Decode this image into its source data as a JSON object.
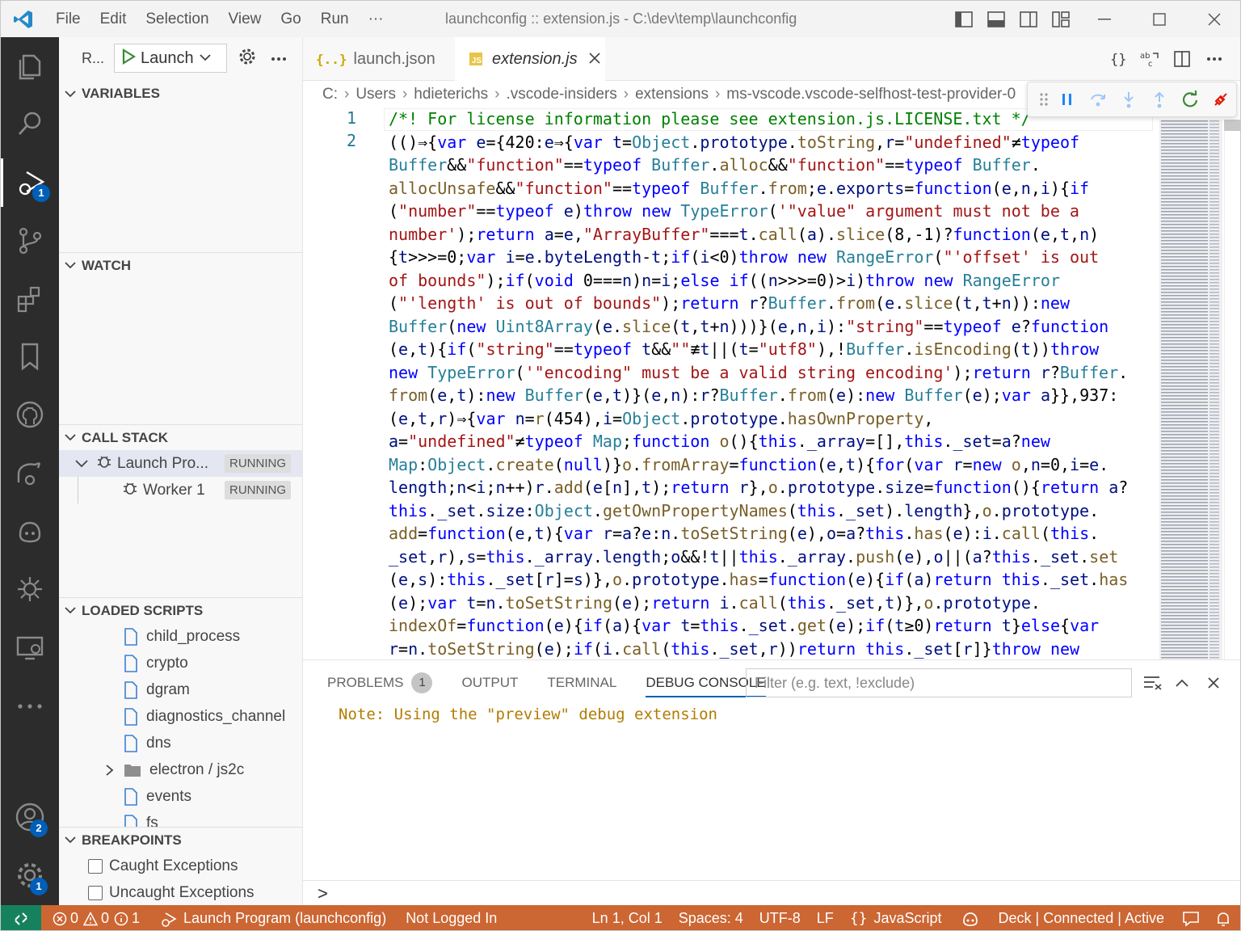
{
  "titlebar": {
    "menus": [
      "File",
      "Edit",
      "Selection",
      "View",
      "Go",
      "Run",
      "···"
    ],
    "title": "launchconfig :: extension.js - C:\\dev\\temp\\launchconfig"
  },
  "activity": {
    "debug_badge": "1",
    "accounts_badge": "2",
    "settings_badge": "1"
  },
  "sidebar": {
    "run_label": "R...",
    "launch_config": "Launch",
    "variables_title": "VARIABLES",
    "watch_title": "WATCH",
    "callstack_title": "CALL STACK",
    "callstack": [
      {
        "name": "Launch Pro...",
        "state": "RUNNING"
      },
      {
        "name": "Worker 1",
        "state": "RUNNING"
      }
    ],
    "loaded_scripts_title": "LOADED SCRIPTS",
    "scripts": [
      "child_process",
      "crypto",
      "dgram",
      "diagnostics_channel",
      "dns",
      "electron / js2c",
      "events",
      "fs"
    ],
    "breakpoints_title": "BREAKPOINTS",
    "breakpoints": [
      "Caught Exceptions",
      "Uncaught Exceptions"
    ]
  },
  "tabs": [
    {
      "label": "launch.json",
      "icon": "{..}"
    },
    {
      "label": "extension.js",
      "icon": "JS"
    }
  ],
  "breadcrumb": [
    "C:",
    "Users",
    "hdieterichs",
    ".vscode-insiders",
    "extensions",
    "ms-vscode.vscode-selfhost-test-provider-0"
  ],
  "editor": {
    "line_numbers": [
      "1",
      "2"
    ]
  },
  "panel": {
    "tabs": [
      "PROBLEMS",
      "OUTPUT",
      "TERMINAL",
      "DEBUG CONSOLE"
    ],
    "problems_count": "1",
    "filter_placeholder": "Filter (e.g. text, !exclude)",
    "console_note": "Note: Using the \"preview\" debug extension",
    "prompt": ">"
  },
  "statusbar": {
    "errors": "0",
    "warnings": "0",
    "infos": "1",
    "debug_session": "Launch Program (launchconfig)",
    "login": "Not Logged In",
    "position": "Ln 1, Col 1",
    "spaces": "Spaces: 4",
    "encoding": "UTF-8",
    "eol": "LF",
    "language": "JavaScript",
    "deck": "Deck | Connected | Active"
  },
  "colors": {
    "statusbar": "#cc6633",
    "remote": "#16825d",
    "accent": "#005fb8",
    "activitybar": "#2c2c2c"
  }
}
